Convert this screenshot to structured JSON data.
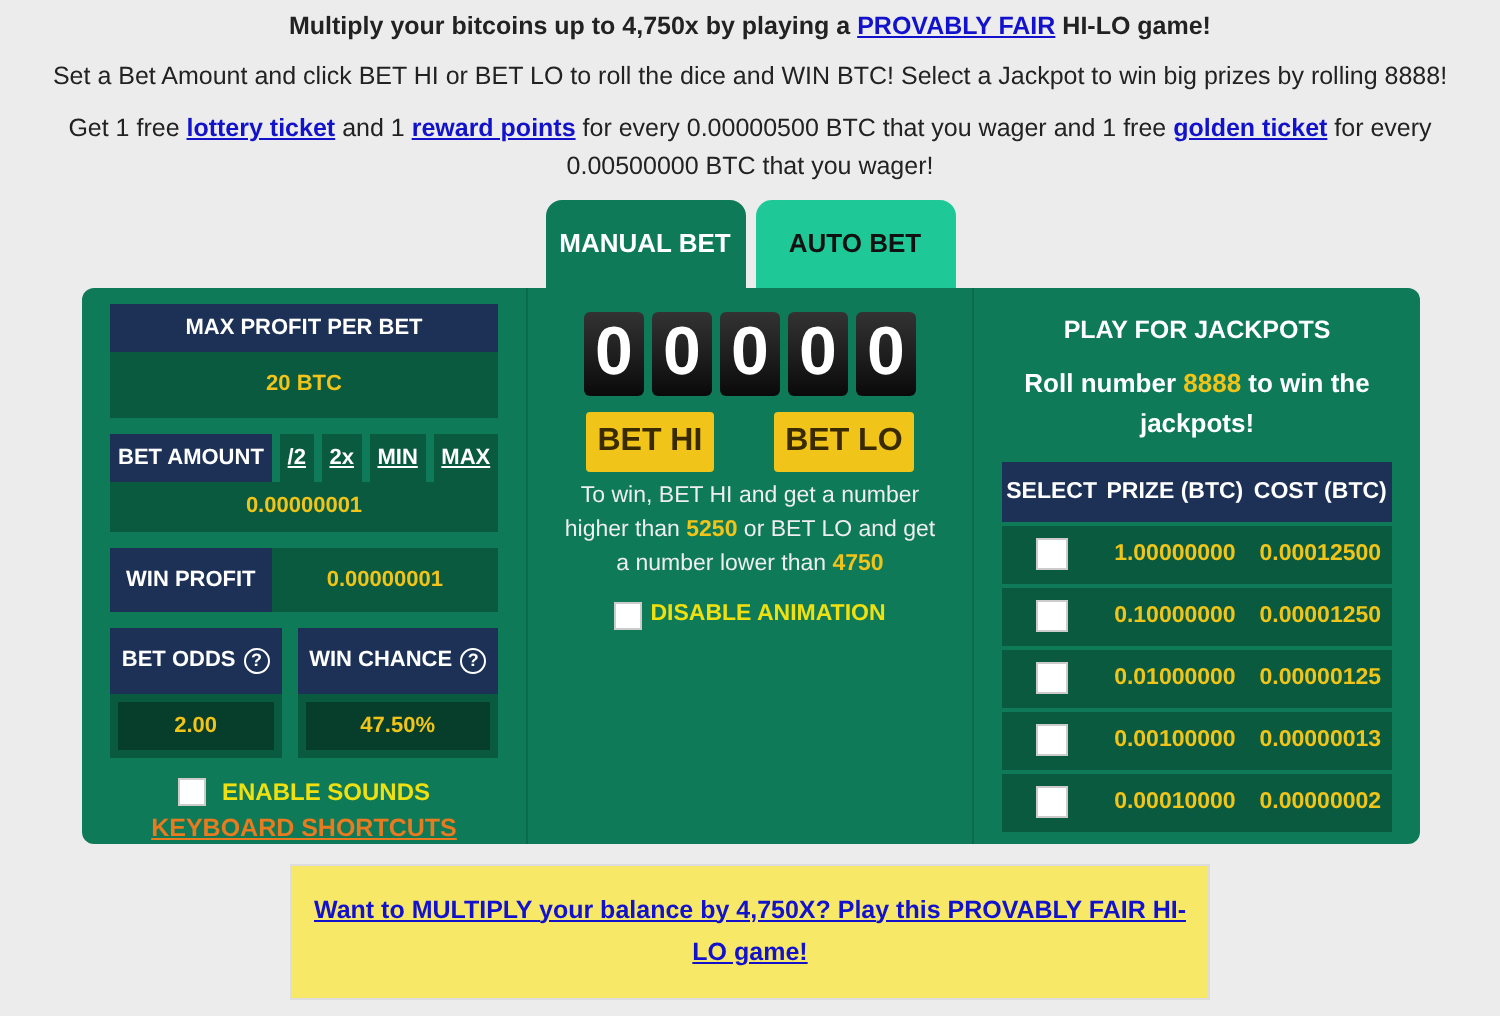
{
  "intro": [
    [
      {
        "text": "Multiply your bitcoins up to 4,750x by playing a ",
        "link": false
      },
      {
        "text": "PROVABLY FAIR",
        "link": true
      },
      {
        "text": " HI-LO game!",
        "link": false
      }
    ],
    [
      {
        "text": "Set a Bet Amount and click BET HI or BET LO to roll the dice and WIN BTC! Select a Jackpot to win big prizes by rolling 8888!",
        "link": false
      }
    ],
    [
      {
        "text": "Get 1 free ",
        "link": false
      },
      {
        "text": "lottery ticket",
        "link": true
      },
      {
        "text": " and 1 ",
        "link": false
      },
      {
        "text": "reward points",
        "link": true
      },
      {
        "text": " for every 0.00000500 BTC that you wager and 1 free ",
        "link": false
      },
      {
        "text": "golden ticket",
        "link": true
      },
      {
        "text": " for every 0.00500000 BTC that you wager!",
        "link": false
      }
    ]
  ],
  "tabs": [
    {
      "label": "MANUAL BET",
      "selected": true
    },
    {
      "label": "AUTO BET",
      "selected": false
    }
  ],
  "max_profit": {
    "label": "MAX PROFIT PER BET",
    "value": "20 BTC"
  },
  "bet_amount": {
    "label": "BET AMOUNT",
    "buttons": [
      "/2",
      "2x",
      "MIN",
      "MAX"
    ],
    "value": "0.00000001"
  },
  "win_profit": {
    "label": "WIN PROFIT",
    "value": "0.00000001"
  },
  "stats": [
    {
      "label": "BET ODDS",
      "help": "?",
      "value": "2.00"
    },
    {
      "label": "WIN CHANCE",
      "help": "?",
      "value": "47.50%"
    }
  ],
  "enable_sounds": {
    "label": "ENABLE SOUNDS",
    "checked": false
  },
  "keyboard_shortcuts": "KEYBOARD SHORTCUTS",
  "digits": [
    "0",
    "0",
    "0",
    "0",
    "0"
  ],
  "bet_buttons": [
    "BET HI",
    "BET LO"
  ],
  "rule": [
    {
      "text": "To win, BET HI and get a number higher than ",
      "kind": "plain"
    },
    {
      "text": "5250",
      "kind": "value"
    },
    {
      "text": " or BET LO and get a number lower than ",
      "kind": "plain"
    },
    {
      "text": "4750",
      "kind": "value"
    }
  ],
  "disable_animation": {
    "label": "DISABLE ANIMATION",
    "checked": false
  },
  "jackpots": {
    "title": "PLAY FOR JACKPOTS",
    "note": [
      {
        "text": "Roll number ",
        "kind": "plain"
      },
      {
        "text": "8888",
        "kind": "value"
      },
      {
        "text": " to win the jackpots!",
        "kind": "plain"
      }
    ],
    "columns": [
      "SELECT",
      "PRIZE (BTC)",
      "COST (BTC)"
    ],
    "rows": [
      {
        "checked": false,
        "prize": "1.00000000",
        "cost": "0.00012500"
      },
      {
        "checked": false,
        "prize": "0.10000000",
        "cost": "0.00001250"
      },
      {
        "checked": false,
        "prize": "0.01000000",
        "cost": "0.00000125"
      },
      {
        "checked": false,
        "prize": "0.00100000",
        "cost": "0.00000013"
      },
      {
        "checked": false,
        "prize": "0.00010000",
        "cost": "0.00000002"
      }
    ]
  },
  "promo": "Want to MULTIPLY your balance by 4,750X? Play this PROVABLY FAIR HI-LO game!"
}
